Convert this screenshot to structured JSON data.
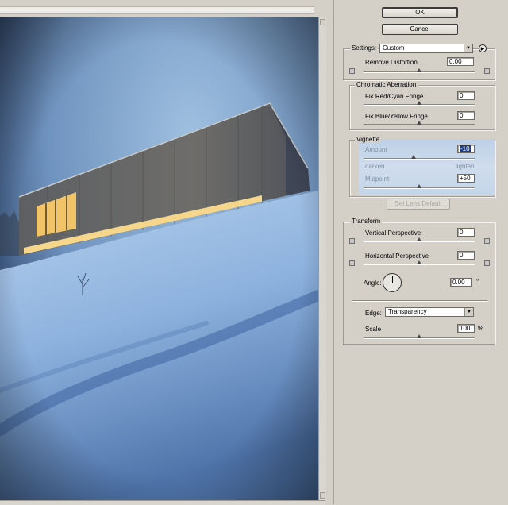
{
  "buttons": {
    "ok": "OK",
    "cancel": "Cancel",
    "set_lens_default": "Set Lens Default"
  },
  "settings": {
    "label": "Settings:",
    "value": "Custom"
  },
  "remove_distortion": {
    "label": "Remove Distortion",
    "value": "0.00"
  },
  "chromatic": {
    "title": "Chromatic Aberration",
    "red_cyan": {
      "label": "Fix Red/Cyan Fringe",
      "value": "0"
    },
    "blue_yellow": {
      "label": "Fix Blue/Yellow Fringe",
      "value": "0"
    }
  },
  "vignette": {
    "title": "Vignette",
    "amount": {
      "label": "Amount",
      "value": "-10"
    },
    "darken": "darken",
    "lighten": "lighten",
    "midpoint": {
      "label": "Midpoint",
      "value": "+50"
    }
  },
  "transform": {
    "title": "Transform",
    "vertical": {
      "label": "Vertical Perspective",
      "value": "0"
    },
    "horizontal": {
      "label": "Horizontal Perspective",
      "value": "0"
    },
    "angle": {
      "label": "Angle:",
      "value": "0.00",
      "unit": "°"
    },
    "edge": {
      "label": "Edge:",
      "value": "Transparency"
    },
    "scale": {
      "label": "Scale",
      "value": "100",
      "unit": "%"
    }
  },
  "icons": {
    "menu": "circle-arrow-right-icon",
    "pincushion": "pincushion-icon",
    "barrel": "barrel-icon"
  },
  "colors": {
    "panel_bg": "#d4d0c8",
    "selection": "#1f3c7a",
    "vignette_highlight": "#c5d5ea"
  }
}
